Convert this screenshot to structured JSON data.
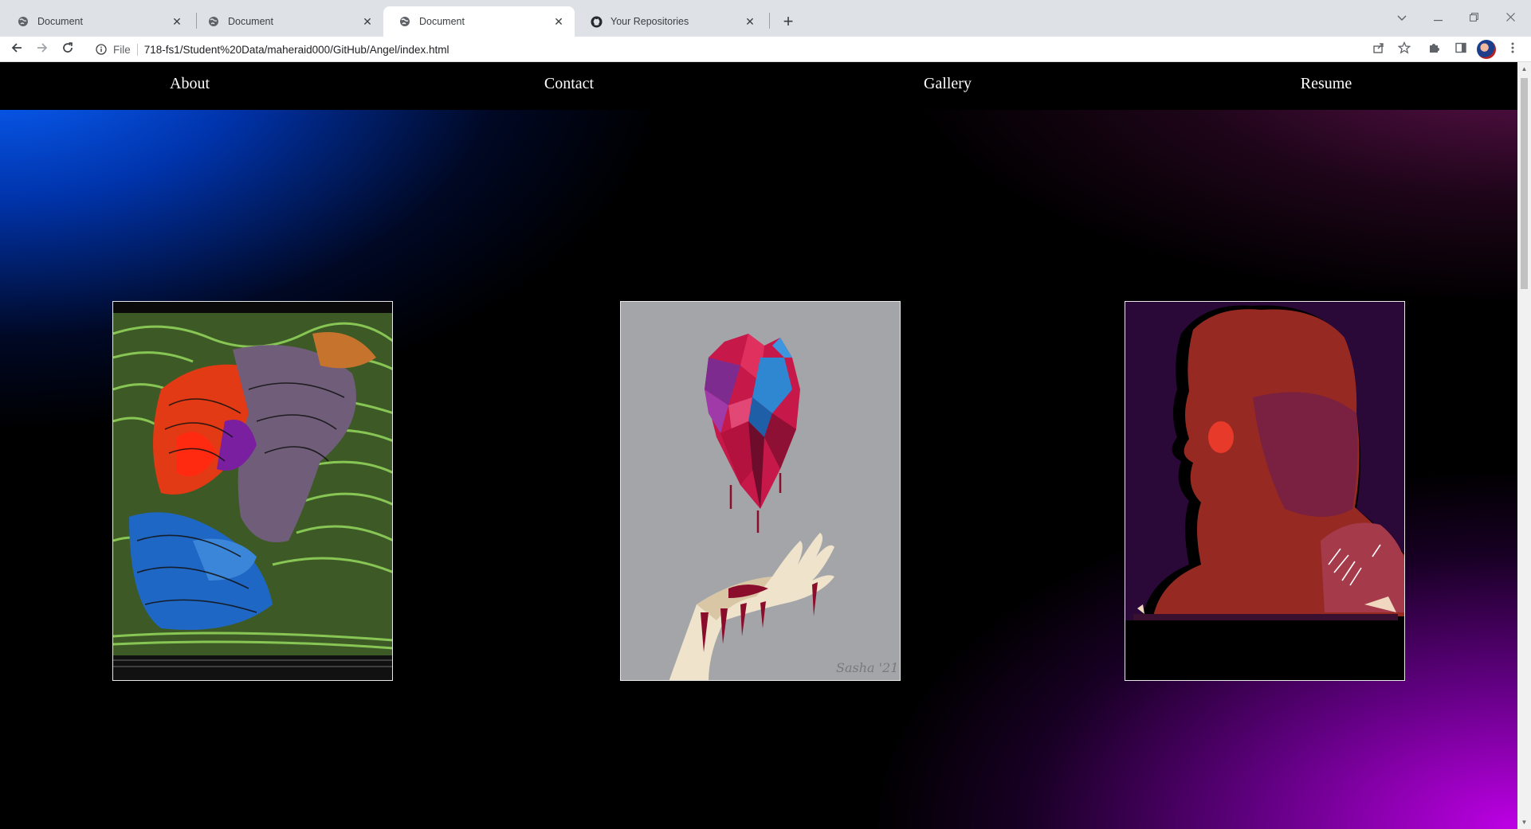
{
  "browser": {
    "tabs": [
      {
        "title": "Document",
        "icon": "globe-icon"
      },
      {
        "title": "Document",
        "icon": "globe-icon"
      },
      {
        "title": "Document",
        "icon": "globe-icon",
        "active": true
      },
      {
        "title": "Your Repositories",
        "icon": "github-icon"
      }
    ],
    "address": {
      "scheme": "File",
      "url": "718-fs1/Student%20Data/maheraid000/GitHub/Angel/index.html"
    }
  },
  "page": {
    "nav": {
      "about": "About",
      "contact": "Contact",
      "gallery": "Gallery",
      "resume": "Resume"
    },
    "gallery": [
      {
        "name": "abstract-portrait-green",
        "bg": "#3d5a26"
      },
      {
        "name": "polygon-heart-hand",
        "bg": "#a4a5a8",
        "signature": "Sasha '21"
      },
      {
        "name": "red-silhouette-portrait",
        "bg": "#2a0838"
      }
    ],
    "colors": {
      "nav_bg": "#000000",
      "nav_text": "#ffffff",
      "gradient_blue": "#0a64ff",
      "gradient_purple": "#be00e6"
    }
  }
}
